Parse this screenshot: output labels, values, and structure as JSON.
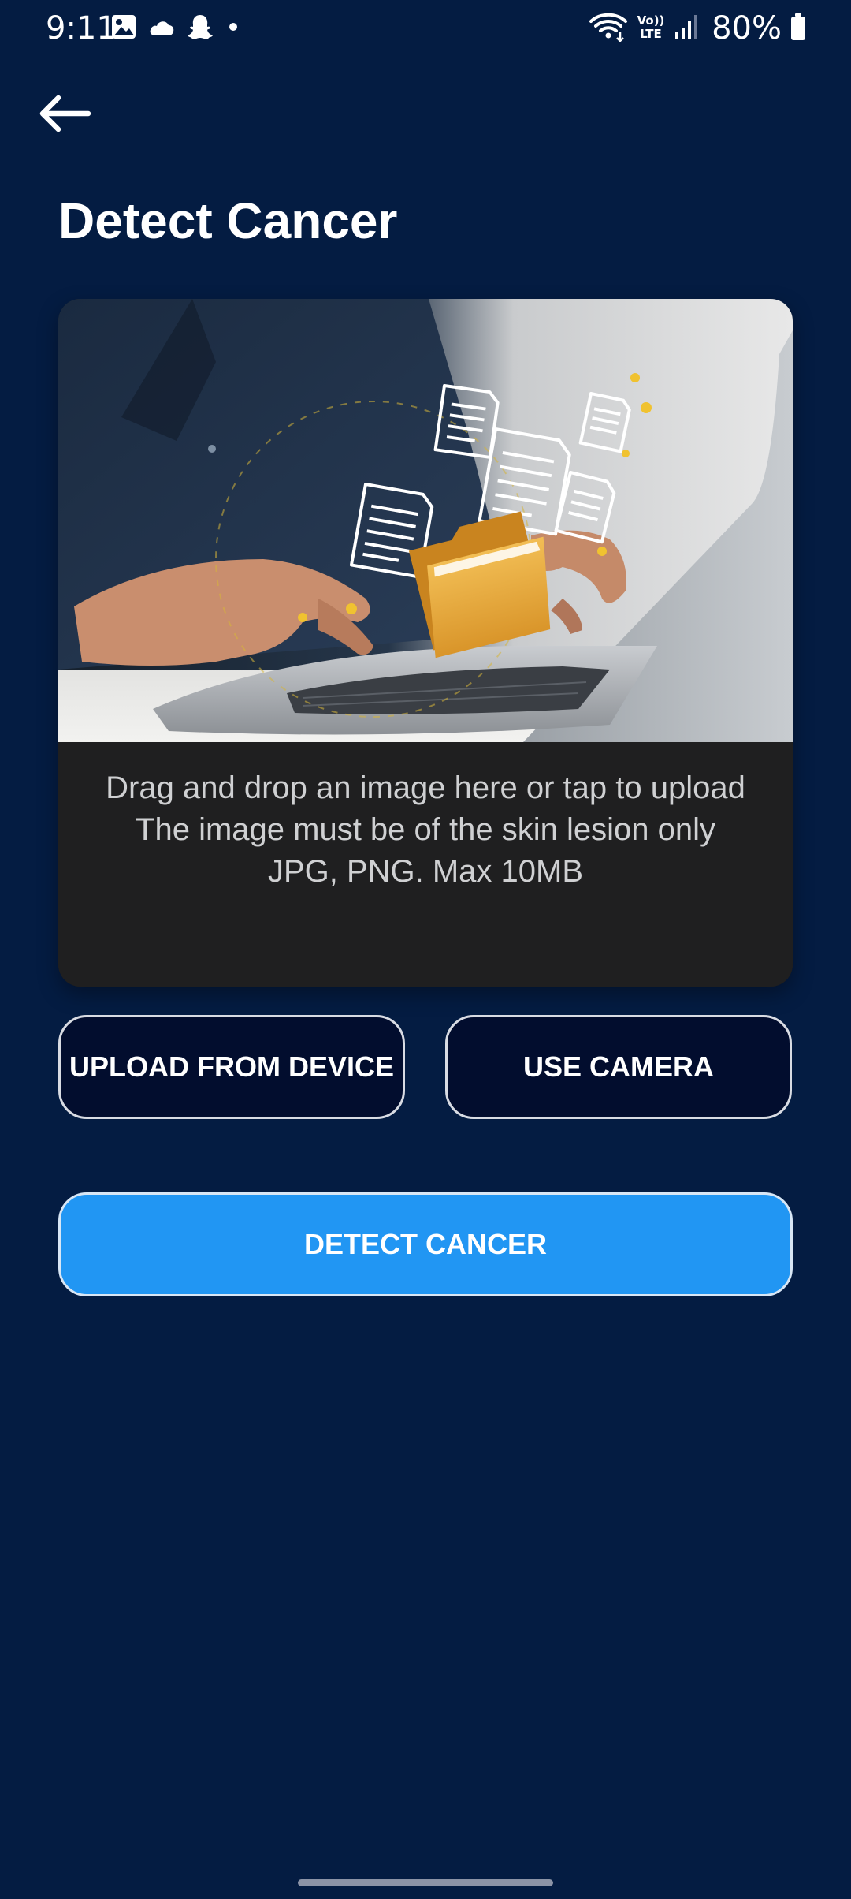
{
  "status_bar": {
    "time": "9:11",
    "battery": "80%",
    "left_icons": [
      "gallery-icon",
      "cloud-icon",
      "snapchat-icon",
      "dot-icon"
    ],
    "right_icons": [
      "wifi-icon",
      "volte-icon",
      "signal-icon",
      "battery-icon"
    ]
  },
  "nav": {
    "back_icon": "arrow-left-icon"
  },
  "page": {
    "title": "Detect Cancer"
  },
  "upload_area": {
    "illustration": "laptop-upload-documents-image",
    "line1": "Drag and drop an image here or tap to upload",
    "line2": "The image must be of the skin lesion only",
    "line3": "JPG, PNG. Max 10MB"
  },
  "buttons": {
    "upload_from_device": "UPLOAD FROM DEVICE",
    "use_camera": "USE CAMERA",
    "detect_cancer": "DETECT CANCER"
  },
  "colors": {
    "background": "#041c42",
    "card": "#1f1f20",
    "primary_button": "#2196f3",
    "outline_button_bg": "#020d2e",
    "outline_border": "#d8dbe3"
  }
}
